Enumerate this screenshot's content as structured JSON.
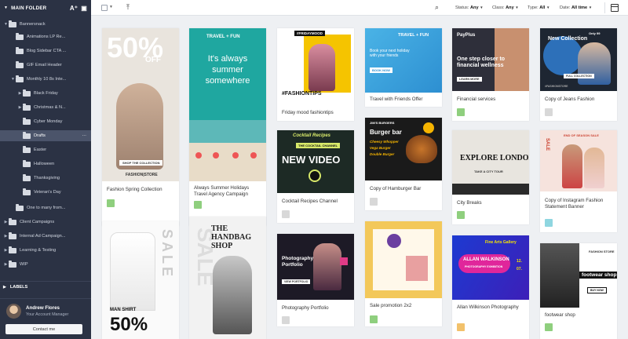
{
  "sidebar": {
    "title": "MAIN FOLDER",
    "items": [
      {
        "label": "Bannersnack",
        "caret": "▼"
      },
      {
        "label": "Animations LP Re...",
        "caret": ""
      },
      {
        "label": "Blog Sidebar CTA ...",
        "caret": ""
      },
      {
        "label": "GIF Email Header",
        "caret": ""
      },
      {
        "label": "Monthly 10 8s Inte...",
        "caret": "▼"
      },
      {
        "label": "Black Friday",
        "caret": "▶"
      },
      {
        "label": "Christmas & N...",
        "caret": "▶"
      },
      {
        "label": "Cyber Monday",
        "caret": ""
      },
      {
        "label": "Drafts",
        "caret": ""
      },
      {
        "label": "Easter",
        "caret": ""
      },
      {
        "label": "Halloween",
        "caret": ""
      },
      {
        "label": "Thanksgiving",
        "caret": ""
      },
      {
        "label": "Veteran's Day",
        "caret": ""
      },
      {
        "label": "One to many from...",
        "caret": ""
      },
      {
        "label": "Client Campaigns",
        "caret": "▶"
      },
      {
        "label": "Internal Ad Campaign...",
        "caret": "▶"
      },
      {
        "label": "Learning & Testing",
        "caret": "▶"
      },
      {
        "label": "WIP",
        "caret": "▶"
      }
    ],
    "more": "···",
    "labels_title": "LABELS",
    "user": {
      "name": "Andrew Flores",
      "role": "Your Account Manager",
      "contact": "Contact me"
    }
  },
  "toolbar": {
    "filters": [
      {
        "label": "Status:",
        "value": "Any"
      },
      {
        "label": "Class:",
        "value": "Any"
      },
      {
        "label": "Type:",
        "value": "All"
      },
      {
        "label": "Date:",
        "value": "All time"
      }
    ]
  },
  "cards": [
    {
      "caption": "Fashion Spring Collection",
      "swatch": "#8fcf7e",
      "t1": "50%",
      "t2": "OFF",
      "t3": "SHOP THE COLLECTION",
      "t4": "FASHION|STORE"
    },
    {
      "caption": "Always Summer Holidays Travel Agency Campaign",
      "swatch": "#8fcf7e",
      "t1": "TRAVEL + FUN",
      "t2": "It's always summer somewhere"
    },
    {
      "caption": "Friday mood fashiontips",
      "swatch": "",
      "t1": "#FRIDAYMOOD",
      "t2": "#FASHIONTIPS"
    },
    {
      "caption": "Travel with Friends Offer",
      "swatch": "",
      "t1": "TRAVEL + FUN",
      "t2": "Book your next holiday with your friends",
      "t3": "BOOK NOW"
    },
    {
      "caption": "Financial services",
      "swatch": "#8fcf7e",
      "t1": "PayPlus",
      "t2": "One step closer to financial wellness",
      "t3": "LEARN MORE"
    },
    {
      "caption": "Copy of Jeans Fashion",
      "swatch": "#d8d8d8",
      "t1": "Only 99",
      "t2": "New Collection",
      "t3": "FULL COLLECTION",
      "t4": "#FASHIONSTORE"
    },
    {
      "caption": "Cocktail Recipes Channel",
      "swatch": "#d8d8d8",
      "t1": "Cocktail Recipes",
      "t2": "THE COCKTAIL CHANNEL",
      "t3": "NEW VIDEO"
    },
    {
      "caption": "Copy of Hamburger Bar",
      "swatch": "#d8d8d8",
      "t1": "JIM'S BURGERS",
      "t2": "Burger bar",
      "t3": "Cheesy Whopper",
      "t4": "Vega Burger",
      "t5": "Double Burger"
    },
    {
      "caption": "City Breaks",
      "swatch": "#8fcf7e",
      "t1": "EXPLORE LONDON",
      "t2": "TAKE A CITY TOUR"
    },
    {
      "caption": "Copy of Instagram Fashion Statement Banner",
      "swatch": "#8fd6e0",
      "t1": "END OF SEASON SALE",
      "t2": "SALE"
    },
    {
      "caption": "Photography Portfolio",
      "swatch": "#d8d8d8",
      "t1": "Photography Portfolio",
      "t2": "VIEW PORTFOLIO"
    },
    {
      "caption": "Sale promotion 2x2",
      "swatch": "#8fcf7e"
    },
    {
      "caption": "Allan Wilkinson Photography",
      "swatch": "#f2c16b",
      "t1": "Fine Arts Gallery",
      "t2": "ALLAN WALKINSON",
      "t3": "PHOTOGRAPHY EXHIBITION",
      "t4": "12.",
      "t5": "07."
    },
    {
      "caption": "footwear shop",
      "swatch": "#8fcf7e",
      "t1": "FASHION STORE",
      "t2": "footwear shop",
      "t3": "BUY NOW"
    },
    {
      "caption": "",
      "swatch": "",
      "t1": "SALE",
      "t2": "MAN SHIRT",
      "t3": "50%"
    },
    {
      "caption": "",
      "swatch": "",
      "t1": "THE HANDBAG SHOP",
      "t2": "SALE"
    }
  ]
}
